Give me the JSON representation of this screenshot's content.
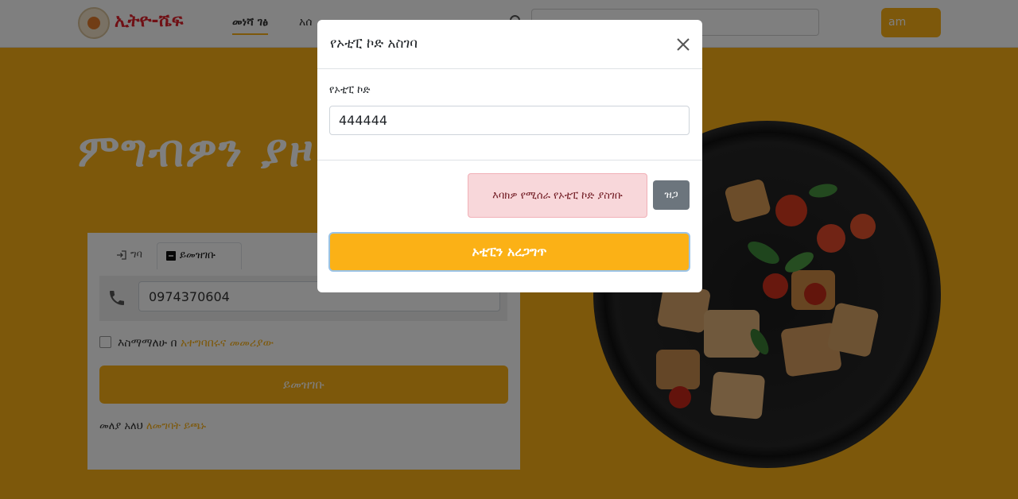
{
  "navbar": {
    "brand": "ኢትዮ-ሼፍ",
    "links": [
      "መነሻ ገፅ",
      "አሰ"
    ],
    "language": "am"
  },
  "hero": {
    "title": "ምግብዎን ያዞ"
  },
  "register_card": {
    "tab_login": "ግባ",
    "tab_register": "ይመዝገቡ",
    "phone_value": "0974370604",
    "agree_text": "እስማማለሁ በ",
    "agree_link": "አተግባበሩና መመሪያው",
    "register_button": "ይመዝገቡ",
    "already_text": "መለያ አለህ",
    "login_link": "ለመግባት ይጫኑ"
  },
  "modal": {
    "title": "የኦቲፒ ኮድ አስገባ",
    "field_label": "የኦቲፒ ኮድ",
    "otp_value": "444444",
    "alert": "እባክዎ የሚሰራ የኦቲፒ ኮድ ያስገቡ",
    "close_button": "ዝጋ",
    "verify_button": "ኦቲፒን አረጋግጥ"
  },
  "colors": {
    "accent": "#fbb116",
    "alert_bg": "#f8d7da",
    "alert_text": "#721c24",
    "secondary_button": "#6c757d"
  }
}
